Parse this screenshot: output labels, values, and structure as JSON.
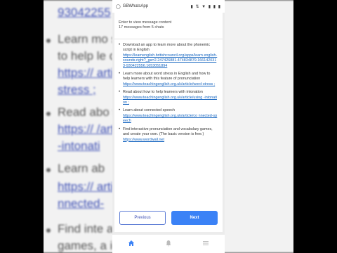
{
  "background": {
    "lines": [
      {
        "text": "93042255",
        "link": true
      },
      {
        "text": "Learn mo                              sh and how",
        "link": false
      },
      {
        "text": "to help le                            onunciation",
        "link": false
      },
      {
        "text": "https://                              article/word-",
        "link": true
      },
      {
        "text": "stress ;",
        "link": true
      },
      {
        "text": "Read abo                              tonation",
        "link": false
      },
      {
        "text": "https://                              /article/using",
        "link": true
      },
      {
        "text": "-intonati",
        "link": true
      },
      {
        "text": "Learn ab",
        "link": false
      },
      {
        "text": "https://                              article/co",
        "link": true
      },
      {
        "text": "nnected-",
        "link": true
      },
      {
        "text": "Find inte                             abulary",
        "link": false
      },
      {
        "text": "games, a                              ic version",
        "link": false
      }
    ]
  },
  "status_bar": {
    "app": "GBWhatsApp",
    "icons": "▮ ⇅ ▼ ▮ ▮ ▮"
  },
  "header": {
    "line1": "Enter to view message content",
    "line2": "17 messages from 5 chats"
  },
  "items": [
    {
      "text": "Download an app to learn more about the phonemic script in English",
      "link": "https://learnenglish.britishcouncil.org/apps/learn english-sounds-right?_ga=2.247426881.474834879.1661420313-930422556.1653051894"
    },
    {
      "text": "Learn more about word stress in English and how to help learners with this feature of pronunciation",
      "link": "https://www.teachingenglish.org.uk/article/word-stress ;"
    },
    {
      "text": "Read about how to help learners with intonation",
      "link": "https://www.teachingenglish.org.uk/article/using -intonation ;"
    },
    {
      "text": "Learn about connected speech",
      "link": "https://www.teachingenglish.org.uk/article/co nnected-speech"
    },
    {
      "text": "Find interactive pronunciation and vocabulary games, and create your own. (The basic version is free.)",
      "link": "https://www.wordwall.net"
    }
  ],
  "buttons": {
    "previous": "Previous",
    "next": "Next"
  },
  "bottom_nav": {
    "home_color": "#3b82f6",
    "icons": [
      "home-icon",
      "bell-icon",
      "menu-icon"
    ]
  }
}
